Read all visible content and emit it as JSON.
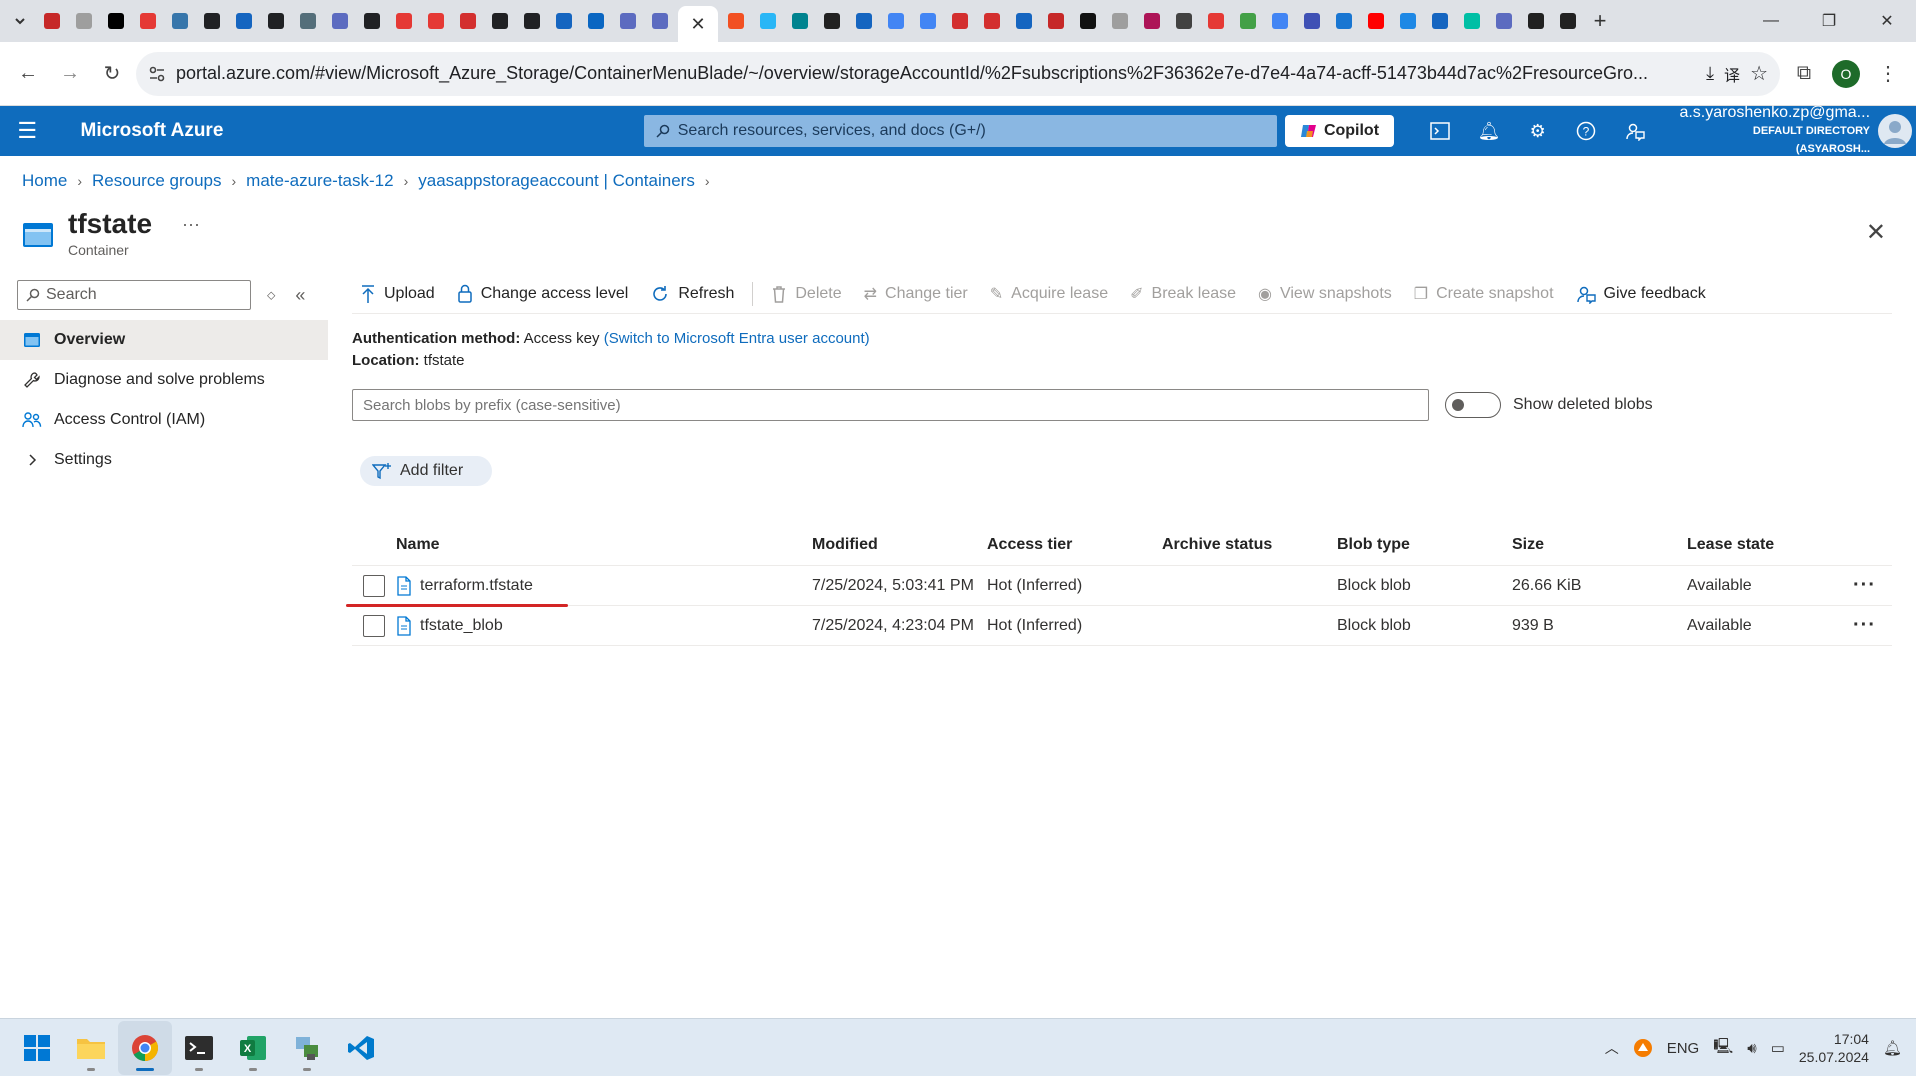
{
  "browser": {
    "tab_colors": [
      "#c62828",
      "#9e9e9e",
      "#000000",
      "#e53935",
      "#3776ab",
      "#202124",
      "#1565c0",
      "#202124",
      "#546e7a",
      "#5c6bc0",
      "#202124",
      "#e53935",
      "#e53935",
      "#d32f2f",
      "#202124",
      "#202124",
      "#1565c0",
      "#0a66c2",
      "#5c6bc0",
      "#5c6bc0"
    ],
    "tab_colors_right": [
      "#f25022",
      "#29b6f6",
      "#00838f",
      "#212121",
      "#1565c0",
      "#4285f4",
      "#4285f4",
      "#d32f2f",
      "#d32f2f",
      "#1565c0",
      "#c62828",
      "#111111",
      "#9e9e9e",
      "#ad1457",
      "#424242",
      "#e53935",
      "#43a047",
      "#4285f4",
      "#3f51b5",
      "#1976d2",
      "#ff0000",
      "#1e88e5",
      "#1565c0",
      "#00bfa5",
      "#5c6bc0",
      "#212121",
      "#212121"
    ],
    "active_tab_close": "✕",
    "new_tab": "+",
    "url": "portal.azure.com/#view/Microsoft_Azure_Storage/ContainerMenuBlade/~/overview/storageAccountId/%2Fsubscriptions%2F36362e7e-d7e4-4a74-acff-51473b44d7ac%2FresourceGro...",
    "profile_initial": "O"
  },
  "azure": {
    "brand": "Microsoft Azure",
    "search_placeholder": "Search resources, services, and docs (G+/)",
    "copilot": "Copilot",
    "account_email": "a.s.yaroshenko.zp@gma...",
    "account_dir": "DEFAULT DIRECTORY (ASYAROSH..."
  },
  "breadcrumb": [
    "Home",
    "Resource groups",
    "mate-azure-task-12",
    "yaasappstorageaccount | Containers"
  ],
  "blade": {
    "title": "tfstate",
    "subtitle": "Container",
    "more": "···"
  },
  "nav": {
    "search_placeholder": "Search",
    "items": [
      {
        "label": "Overview",
        "icon": "container-icon",
        "active": true
      },
      {
        "label": "Diagnose and solve problems",
        "icon": "wrench-icon"
      },
      {
        "label": "Access Control (IAM)",
        "icon": "people-icon"
      },
      {
        "label": "Settings",
        "icon": "chevron-right-icon"
      }
    ]
  },
  "toolbar": {
    "upload": "Upload",
    "change_access": "Change access level",
    "refresh": "Refresh",
    "delete": "Delete",
    "change_tier": "Change tier",
    "acquire_lease": "Acquire lease",
    "break_lease": "Break lease",
    "view_snapshots": "View snapshots",
    "create_snapshot": "Create snapshot",
    "give_feedback": "Give feedback"
  },
  "meta": {
    "auth_label": "Authentication method:",
    "auth_value": "Access key",
    "auth_link": "(Switch to Microsoft Entra user account)",
    "location_label": "Location:",
    "location_value": "tfstate"
  },
  "blobs": {
    "search_placeholder": "Search blobs by prefix (case-sensitive)",
    "show_deleted": "Show deleted blobs",
    "add_filter": "Add filter",
    "columns": [
      "Name",
      "Modified",
      "Access tier",
      "Archive status",
      "Blob type",
      "Size",
      "Lease state"
    ],
    "rows": [
      {
        "name": "terraform.tfstate",
        "modified": "7/25/2024, 5:03:41 PM",
        "tier": "Hot (Inferred)",
        "archive": "",
        "type": "Block blob",
        "size": "26.66 KiB",
        "lease": "Available",
        "more": "···"
      },
      {
        "name": "tfstate_blob",
        "modified": "7/25/2024, 4:23:04 PM",
        "tier": "Hot (Inferred)",
        "archive": "",
        "type": "Block blob",
        "size": "939 B",
        "lease": "Available",
        "more": "···"
      }
    ]
  },
  "taskbar": {
    "apps": [
      "start-icon",
      "file-explorer-icon",
      "chrome-icon",
      "terminal-icon",
      "excel-icon",
      "network-tool-icon",
      "vscode-icon"
    ],
    "language": "ENG",
    "time": "17:04",
    "date": "25.07.2024"
  }
}
